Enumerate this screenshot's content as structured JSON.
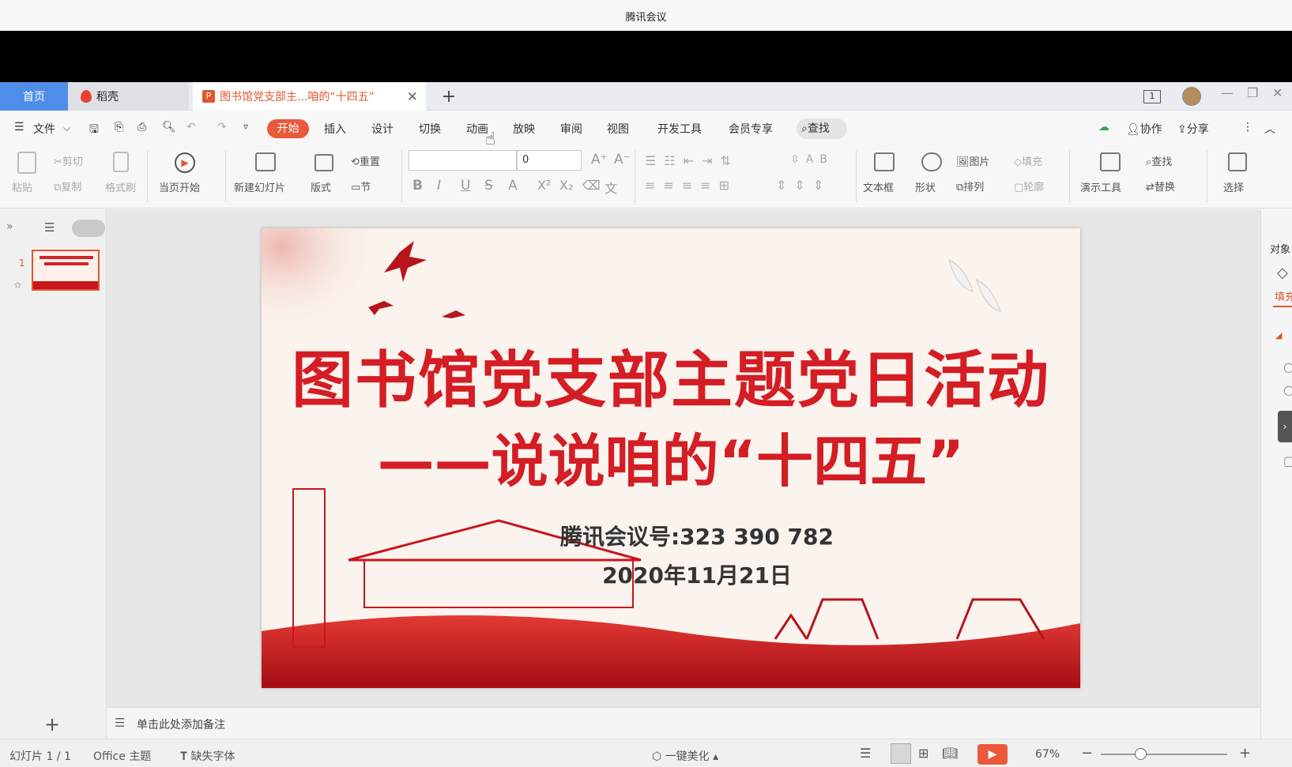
{
  "titlebar": {
    "title": "腾讯会议"
  },
  "tabs": {
    "home": "首页",
    "daoke": "稻壳",
    "doc": "图书馆党支部主...咱的“十四五”",
    "add": "+",
    "close": "✕"
  },
  "window": {
    "page_badge": "1",
    "minimize": "—",
    "restore": "❐",
    "close": "✕"
  },
  "menu": {
    "file": "文件",
    "items": [
      "开始",
      "插入",
      "设计",
      "切换",
      "动画",
      "放映",
      "审阅",
      "视图",
      "开发工具",
      "会员专享"
    ],
    "search": "查找",
    "sync": "",
    "collab": "协作",
    "share": "分享"
  },
  "toolbar": {
    "paste": "粘贴",
    "cut": "剪切",
    "copy": "复制",
    "format_painter": "格式刷",
    "play_from_current": "当页开始",
    "new_slide": "新建幻灯片",
    "layout": "版式",
    "reset": "重置",
    "section": "节",
    "font_size": "0",
    "textbox": "文本框",
    "shape": "形状",
    "picture": "图片",
    "arrange": "排列",
    "fill": "填充",
    "outline": "轮廓",
    "present_tools": "演示工具",
    "find": "查找",
    "replace": "替换",
    "select": "选择"
  },
  "slides_panel": {
    "slide_number": "1",
    "add": "+"
  },
  "slide": {
    "title_line1": "图书馆党支部主题党日活动",
    "title_line2": "——说说咱的“十四五”",
    "meeting_id": "腾讯会议号:323 390 782",
    "date": "2020年11月21日"
  },
  "right_panel": {
    "object": "对象",
    "fill_tab": "填充"
  },
  "notes": {
    "placeholder": "单击此处添加备注"
  },
  "status": {
    "slide_counter": "幻灯片 1 / 1",
    "theme": "Office 主题",
    "missing_fonts": "缺失字体",
    "beautify": "一键美化",
    "zoom": "67%",
    "zoom_minus": "−",
    "zoom_plus": "+"
  },
  "colors": {
    "accent": "#e9593a",
    "tab_home": "#4f8ee8",
    "slide_red": "#c8161d"
  }
}
